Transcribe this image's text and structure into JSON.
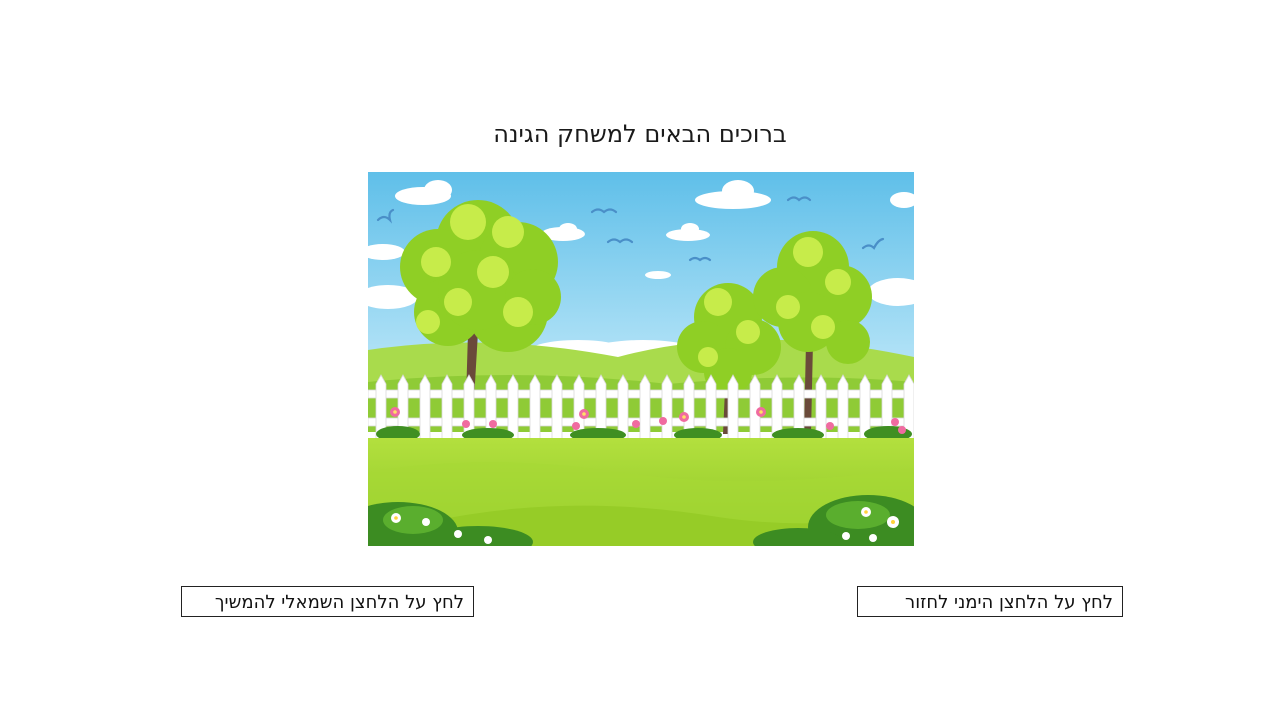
{
  "slide": {
    "title": "ברוכים הבאים למשחק הגינה",
    "continue_instruction": "לחץ על הלחצן השמאלי להמשיך",
    "back_instruction": "לחץ על הלחצן הימני לחזור"
  },
  "illustration": {
    "icon": "garden-scene-icon",
    "colors": {
      "sky_top": "#5fbfe9",
      "sky_bottom": "#c9ebfa",
      "hills": "#a7d84a",
      "lawn": "#9ccc2e",
      "foliage": "#9fd82b",
      "trunk": "#6a4a3a",
      "fence": "#ffffff",
      "flower": "#f06ba0"
    }
  }
}
